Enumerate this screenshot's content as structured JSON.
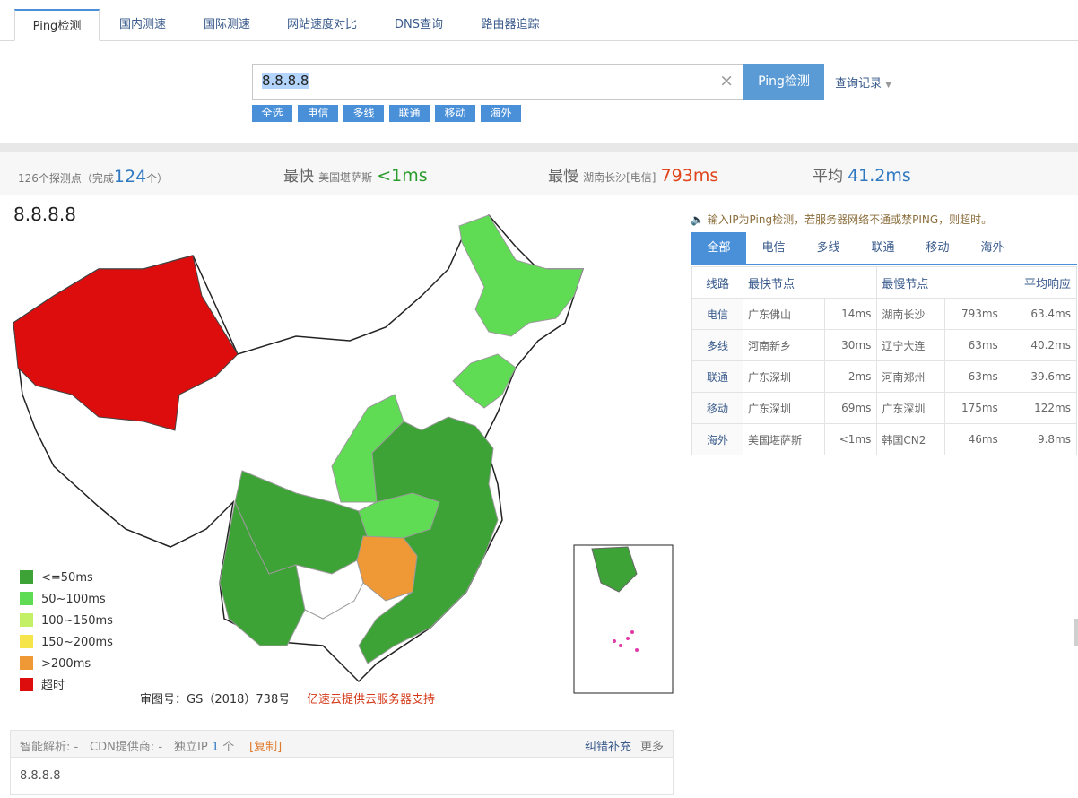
{
  "tabs": [
    "Ping检测",
    "国内测速",
    "国际测速",
    "网站速度对比",
    "DNS查询",
    "路由器追踪"
  ],
  "search": {
    "value": "8.8.8.8",
    "clear_icon": "close-icon"
  },
  "ping_button": "Ping检测",
  "history_label": "查询记录",
  "filters": [
    "全选",
    "电信",
    "多线",
    "联通",
    "移动",
    "海外"
  ],
  "stats": {
    "nodes_prefix": "126个探测点（完成",
    "nodes_done": "124",
    "nodes_suffix": "个）",
    "fastest_label": "最快",
    "fastest_node": "美国堪萨斯",
    "fastest_value": "<1ms",
    "slowest_label": "最慢",
    "slowest_node": "湖南长沙[电信]",
    "slowest_value": "793ms",
    "average_label": "平均",
    "average_value": "41.2ms"
  },
  "map": {
    "ip_title": "8.8.8.8",
    "legend": [
      {
        "label": "<=50ms",
        "color": "#3ea337"
      },
      {
        "label": "50~100ms",
        "color": "#5fdc54"
      },
      {
        "label": "100~150ms",
        "color": "#c4f067"
      },
      {
        "label": "150~200ms",
        "color": "#f5e54a"
      },
      {
        "label": ">200ms",
        "color": "#ef9836"
      },
      {
        "label": "超时",
        "color": "#dd0d0d"
      }
    ],
    "approval": "审图号：GS（2018）738号",
    "sponsor": "亿速云提供云服务器支持"
  },
  "notice": "输入IP为Ping检测，若服务器网络不通或禁PING，则超时。",
  "result_tabs": [
    "全部",
    "电信",
    "多线",
    "联通",
    "移动",
    "海外"
  ],
  "table": {
    "headers": {
      "line": "线路",
      "fastest": "最快节点",
      "slowest": "最慢节点",
      "average": "平均响应"
    },
    "rows": [
      {
        "line": "电信",
        "fast_node": "广东佛山",
        "fast_ms": "14ms",
        "slow_node": "湖南长沙",
        "slow_ms": "793ms",
        "avg": "63.4ms"
      },
      {
        "line": "多线",
        "fast_node": "河南新乡",
        "fast_ms": "30ms",
        "slow_node": "辽宁大连",
        "slow_ms": "63ms",
        "avg": "40.2ms"
      },
      {
        "line": "联通",
        "fast_node": "广东深圳",
        "fast_ms": "2ms",
        "slow_node": "河南郑州",
        "slow_ms": "63ms",
        "avg": "39.6ms"
      },
      {
        "line": "移动",
        "fast_node": "广东深圳",
        "fast_ms": "69ms",
        "slow_node": "广东深圳",
        "slow_ms": "175ms",
        "avg": "122ms"
      },
      {
        "line": "海外",
        "fast_node": "美国堪萨斯",
        "fast_ms": "<1ms",
        "slow_node": "韩国CN2",
        "slow_ms": "46ms",
        "avg": "9.8ms"
      }
    ]
  },
  "info_bar": {
    "smart": "智能解析: -",
    "cdn": "CDN提供商: -",
    "ip_label": "独立IP",
    "ip_count": "1",
    "ip_unit": "个",
    "copy": "[复制]",
    "report": "纠错补充",
    "more": "更多"
  },
  "ip_list": "8.8.8.8"
}
